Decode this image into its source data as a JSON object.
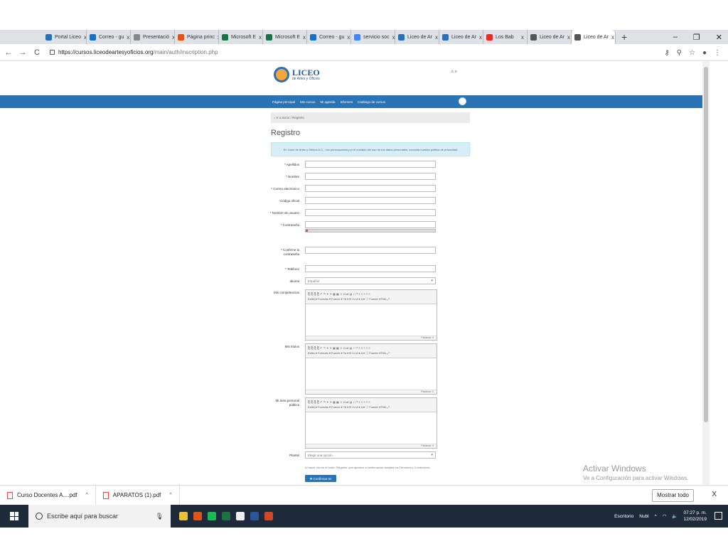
{
  "browser": {
    "tabs": [
      {
        "label": "Portal Liceo",
        "color": "#2d6fb7"
      },
      {
        "label": "Correo - gu",
        "color": "#1b6ec2"
      },
      {
        "label": "Presentació",
        "color": "#888888"
      },
      {
        "label": "Página princ",
        "color": "#e0541a"
      },
      {
        "label": "Microsoft E",
        "color": "#1e7145"
      },
      {
        "label": "Microsoft E",
        "color": "#1e7145"
      },
      {
        "label": "Correo - gu",
        "color": "#1b6ec2"
      },
      {
        "label": "servicio soc",
        "color": "#4285f4"
      },
      {
        "label": "Liceo de Ar",
        "color": "#2d6fb7"
      },
      {
        "label": "Liceo de Ar",
        "color": "#2d6fb7"
      },
      {
        "label": "Los Bab",
        "color": "#e52d27"
      },
      {
        "label": "Liceo de Ar",
        "color": "#555555"
      },
      {
        "label": "Liceo de Ar",
        "color": "#555555"
      }
    ],
    "close_glyph": "x",
    "new_tab": "+",
    "url_host": "https://cursos.liceodeartesyoficios.org",
    "url_path": "/main/auth/inscription.php"
  },
  "site": {
    "logo_title": "LICEO",
    "logo_subtitle": "de Artes y Oficios",
    "top_right": "⚠ ≡",
    "menu": [
      "Página principal",
      "Mis cursos",
      "Mi agenda",
      "Informes",
      "Catálogo de cursos"
    ],
    "breadcrumb": "⌂ Ir a Inicio  /  Registro",
    "title": "Registro",
    "info": "En Liceo de Artes y Oficios A.C., nos preocupamos por el cuidado del uso de tus datos personales, consulta nuestra política de privacidad"
  },
  "form": {
    "apellidos": "* Apellidos",
    "nombre": "* Nombre",
    "correo": "* Correo electrónico",
    "codigo": "Código oficial",
    "usuario": "* Nombre de usuario",
    "contrasena": "* Contraseña",
    "confirmar": "* Confirme la contraseña",
    "telefono": "* Teléfono",
    "idioma_label": "Idioma",
    "idioma_value": "Español",
    "competencias": "Mis competencias",
    "titulos": "Mis títulos",
    "area_personal": "Mi área personal pública",
    "plantel": "Plantel",
    "plantel_placeholder": "Elegir una opción",
    "editor_tools_1": "⎘ ⎘ ⎘ ⎘  ↶ ↷  ⚭ ⚭ ▦ ▦ ☺ Ω ⇄ ▤  ⁝ ⁝ ❝ ≡  ≡ ≡ ≡ ≡",
    "editor_tools_2": "Estilo ▾  Formato ▾  Fuente ▾  Ta ▾  B I U A ▾ A ▾ ⓘ Fuente HTML ⤢",
    "word_count": "Palabras: 0",
    "terms": "Al hacer clic en el botón 'Registro' que aparece a continuación aceptas los Términos y Condiciones",
    "submit": "✚ Confirmar mi registro"
  },
  "watermark": {
    "line1": "Activar Windows",
    "line2": "Ve a Configuración para activar Windows."
  },
  "downloads": {
    "items": [
      "Curso Docentes A....pdf",
      "APARATOS (1).pdf"
    ],
    "caret": "^",
    "show_all": "Mostrar todo",
    "close": "X"
  },
  "taskbar": {
    "search_placeholder": "Escribe aquí para buscar",
    "icon_colors": [
      "#e8c23a",
      "#e0541a",
      "#1db954",
      "#1e7145",
      "#eeeeee",
      "#2b579a",
      "#d24726"
    ],
    "tray_label": "Escritorio",
    "weather": "Nubl",
    "time": "07:27 p. m.",
    "date": "12/02/2019"
  }
}
